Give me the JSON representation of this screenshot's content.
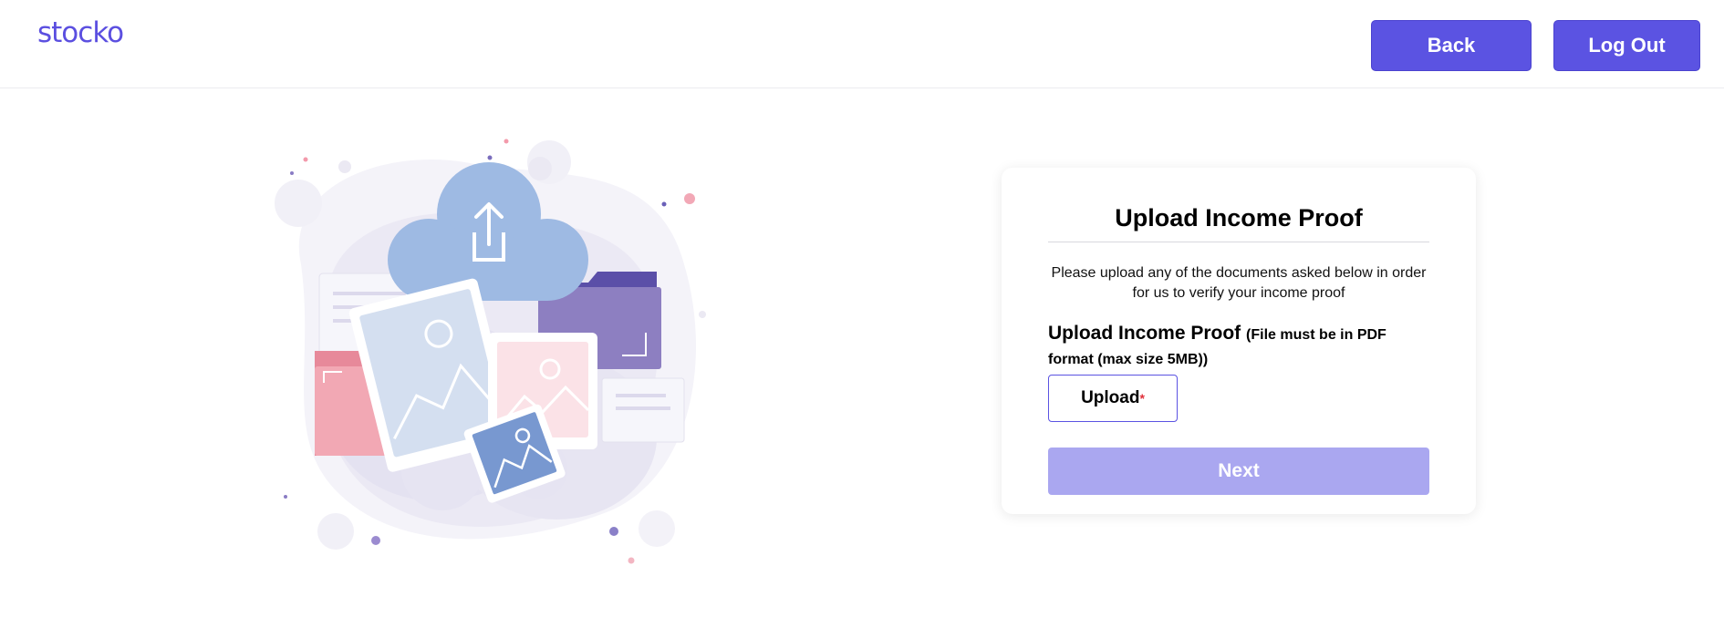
{
  "app": {
    "logo": "stocko"
  },
  "header": {
    "back_label": "Back",
    "logout_label": "Log Out"
  },
  "card": {
    "title": "Upload Income Proof",
    "description": "Please upload any of the documents asked below in order for us to verify your income proof",
    "upload_label": "Upload Income Proof",
    "upload_note": "(File must be in PDF format (max size 5MB))",
    "upload_button": "Upload",
    "required_marker": "*",
    "next_button": "Next"
  },
  "colors": {
    "brand": "#5b53e2",
    "next_disabled": "#aaa7f0",
    "required": "#e0303a"
  },
  "icons": {
    "illustration": "cloud-upload-documents-illustration"
  }
}
